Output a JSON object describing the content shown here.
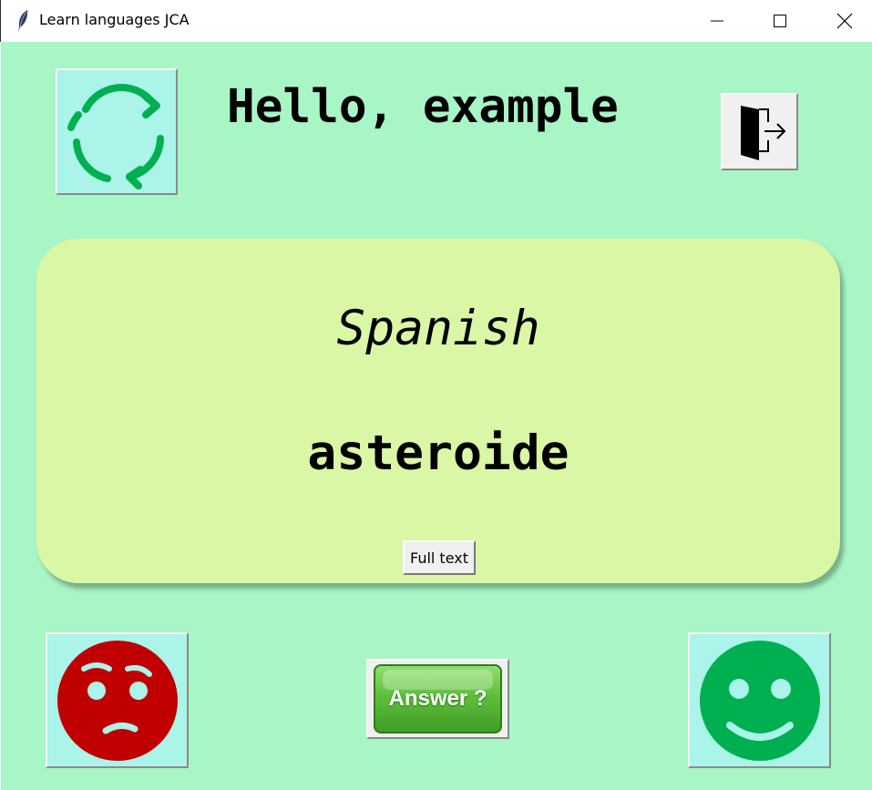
{
  "window": {
    "title": "Learn languages JCA",
    "app_icon": "feather-icon",
    "controls": [
      "minimize-icon",
      "maximize-icon",
      "close-icon"
    ]
  },
  "header": {
    "greeting": "Hello, example",
    "refresh_icon": "refresh-cycle-icon",
    "exit_icon": "exit-door-icon"
  },
  "card": {
    "language": "Spanish",
    "word": "asteroide",
    "full_text_label": "Full text"
  },
  "actions": {
    "wrong_icon": "sad-face-icon",
    "right_icon": "happy-face-icon",
    "answer_label": "Answer ?"
  },
  "colors": {
    "background": "#a8f5c5",
    "card": "#daf7a6",
    "button_face": "#aaf4ea",
    "refresh_green": "#00b050",
    "sad_red": "#c00000",
    "happy_green": "#00b050",
    "answer_green": "#5fbf3c"
  }
}
